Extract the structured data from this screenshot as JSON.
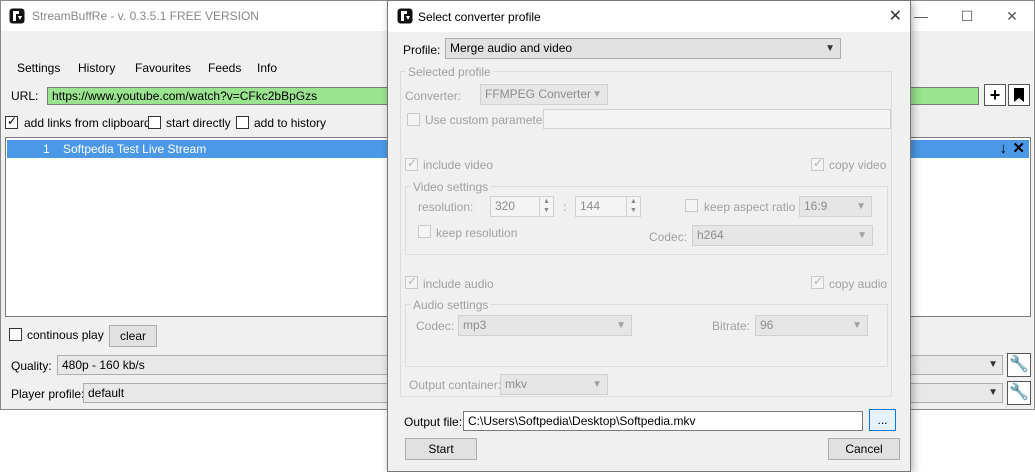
{
  "main_window": {
    "title": "StreamBuffRe - v. 0.3.5.1 FREE VERSION",
    "menu": [
      "Settings",
      "History",
      "Favourites",
      "Feeds",
      "Info"
    ],
    "url_label": "URL:",
    "url_value": "https://www.youtube.com/watch?v=CFkc2bBpGzs",
    "options": {
      "add_links_label": "add links from clipboard",
      "add_links_checked": true,
      "start_directly_label": "start directly",
      "start_directly_checked": false,
      "add_history_label": "add to history",
      "add_history_checked": false
    },
    "list": [
      {
        "index": "1",
        "name": "Softpedia Test Live Stream"
      }
    ],
    "continuous_play_label": "continous play",
    "clear_label": "clear",
    "quality_label": "Quality:",
    "quality_value": "480p - 160 kb/s",
    "player_profile_label": "Player profile:",
    "player_profile_value": "default"
  },
  "dialog": {
    "title": "Select converter profile",
    "profile_label": "Profile:",
    "profile_value": "Merge audio and video",
    "selected_profile_group": "Selected profile",
    "converter_label": "Converter:",
    "converter_value": "FFMPEG Converter",
    "custom_param_label": "Use custom parameter:",
    "include_video_label": "include video",
    "copy_video_label": "copy video",
    "video_settings_group": "Video settings",
    "resolution_label": "resolution:",
    "res_width": "320",
    "res_separator": ":",
    "res_height": "144",
    "keep_aspect_label": "keep aspect ratio",
    "aspect_value": "16:9",
    "keep_resolution_label": "keep resolution",
    "video_codec_label": "Codec:",
    "video_codec_value": "h264",
    "include_audio_label": "include audio",
    "copy_audio_label": "copy audio",
    "audio_settings_group": "Audio settings",
    "audio_codec_label": "Codec:",
    "audio_codec_value": "mp3",
    "bitrate_label": "Bitrate:",
    "bitrate_value": "96",
    "output_container_label": "Output container:",
    "output_container_value": "mkv",
    "output_file_label": "Output file:",
    "output_file_value": "C:\\Users\\Softpedia\\Desktop\\Softpedia.mkv",
    "browse_label": "...",
    "start_label": "Start",
    "cancel_label": "Cancel"
  },
  "colors": {
    "url_bg": "#9ae38f",
    "selection_bg": "#4a98e6"
  }
}
